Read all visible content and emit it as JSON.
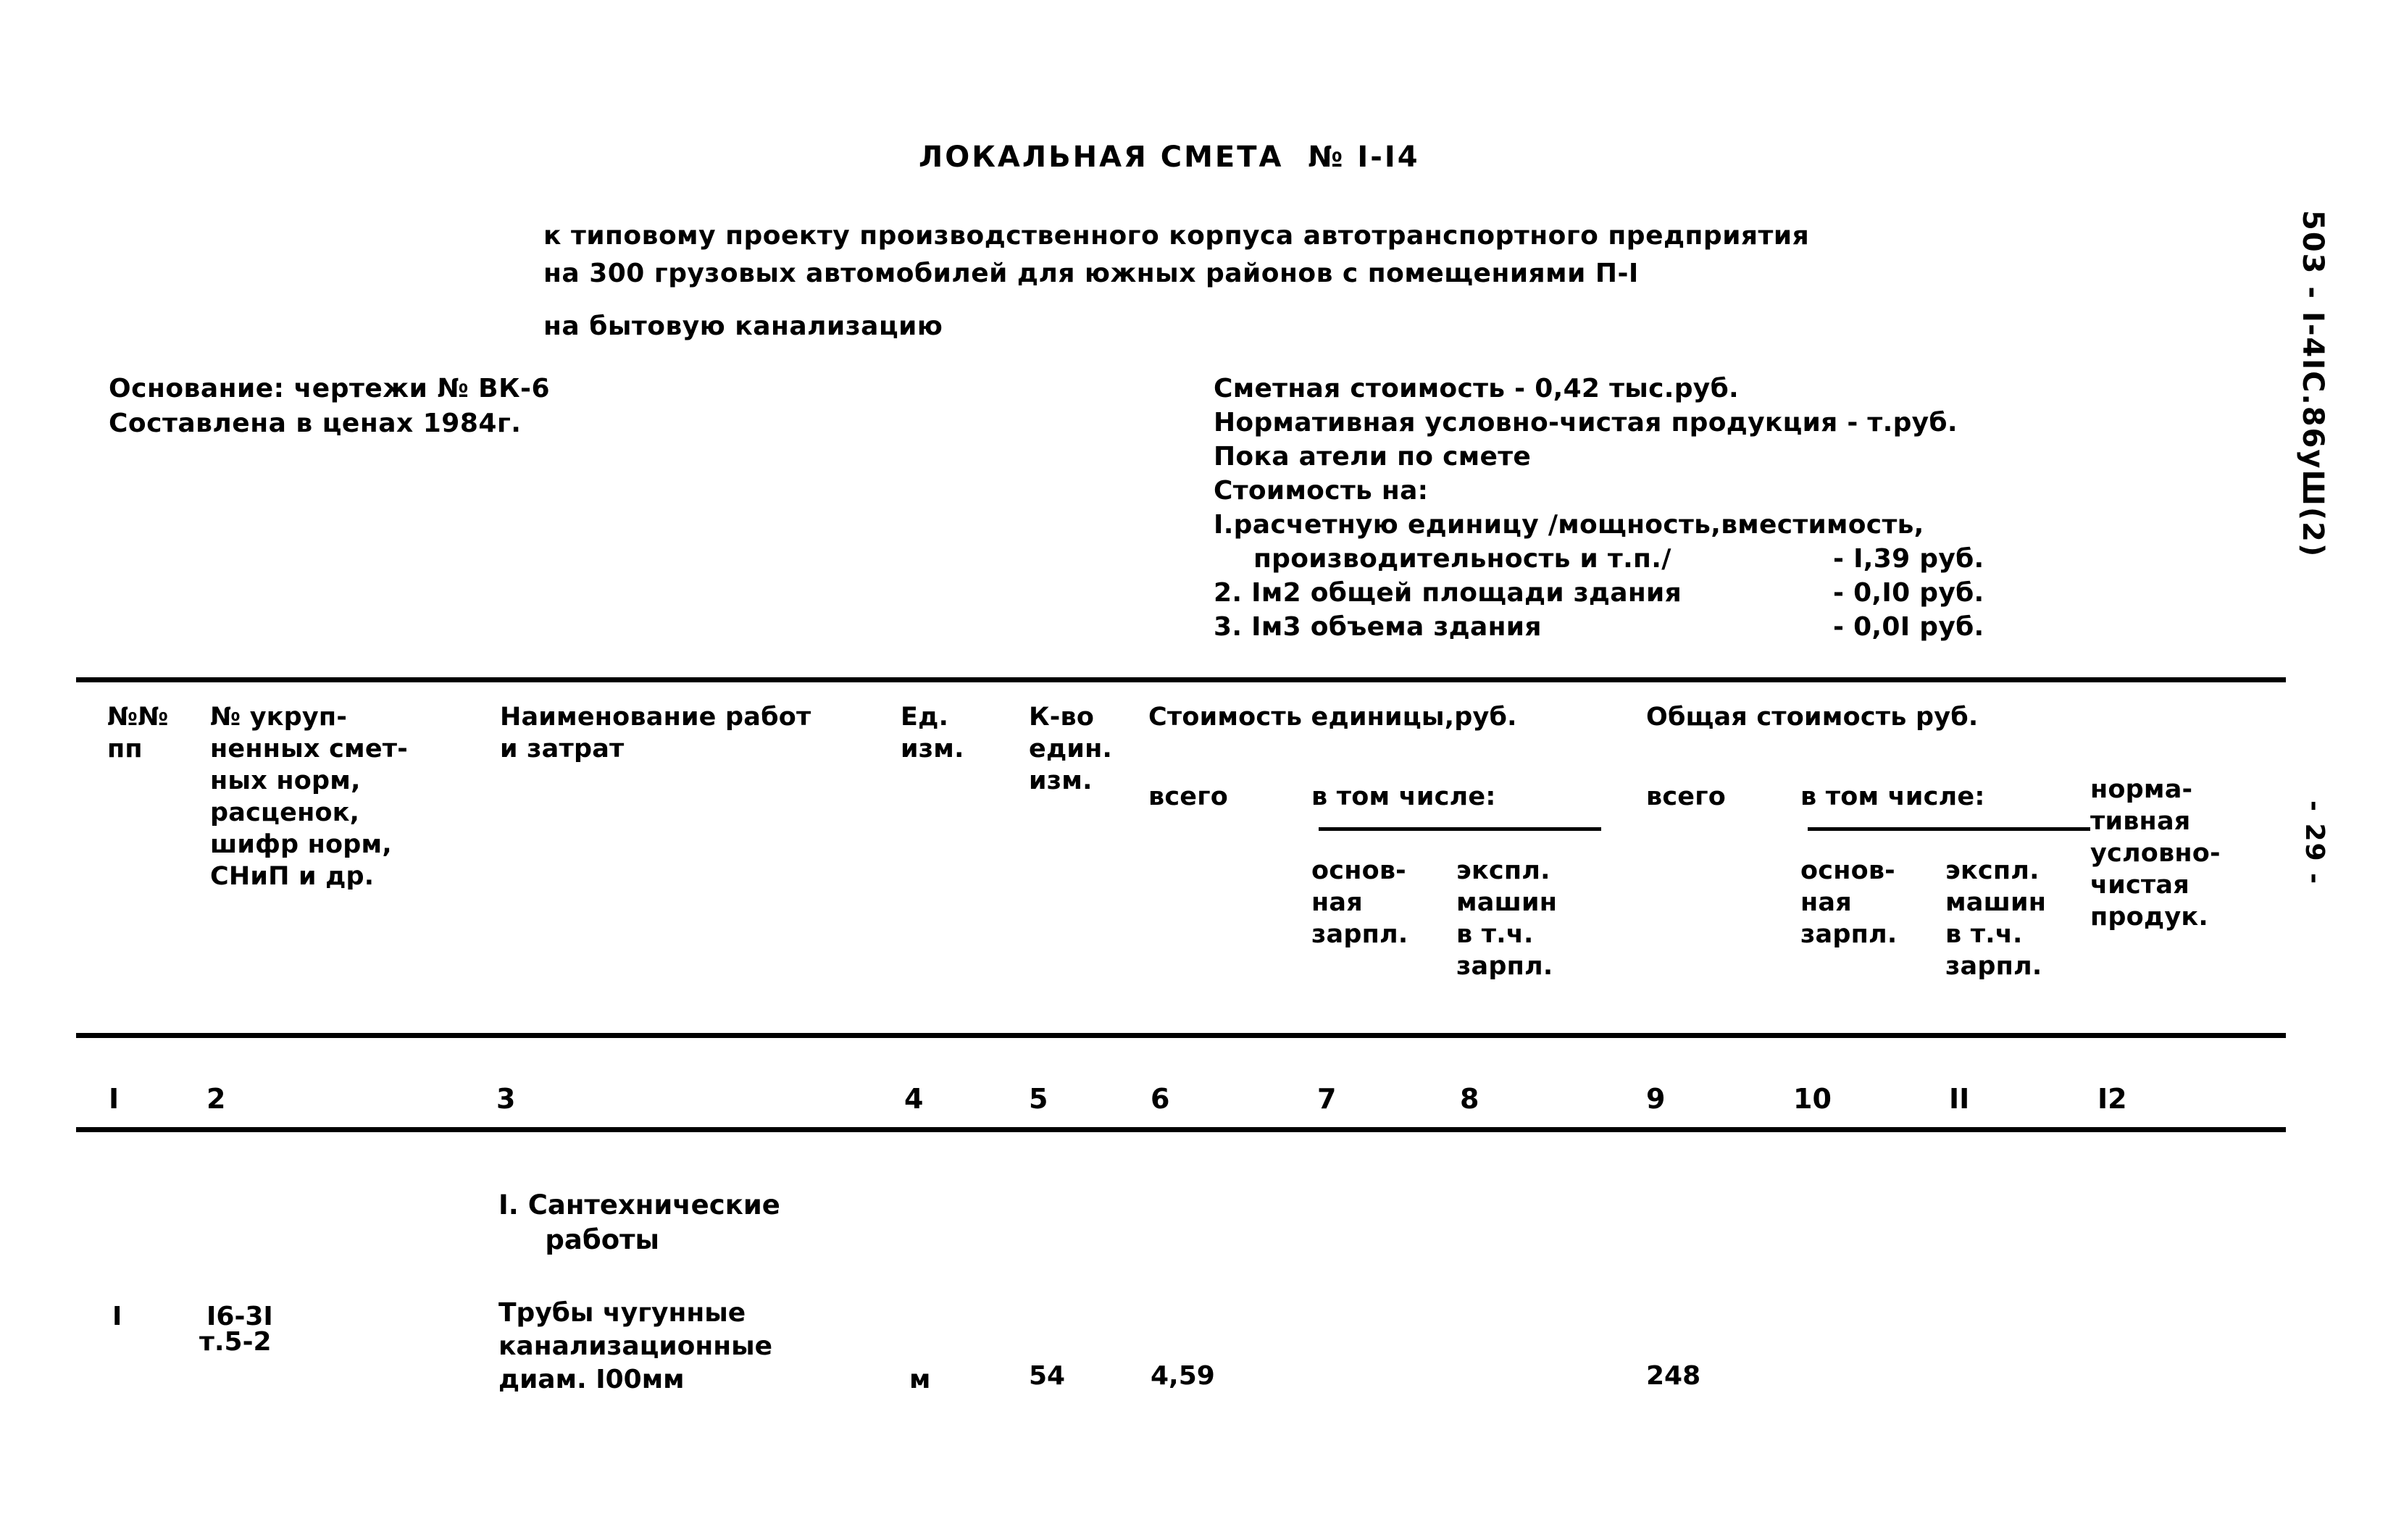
{
  "document": {
    "title": "ЛОКАЛЬНАЯ СМЕТА  № I-I4",
    "subtitle_line1": "к типовому проекту производственного корпуса автотранспортного предприятия",
    "subtitle_line2": "на 300 грузовых автомобилей для южных районов с помещениями П-I",
    "subtitle_line3": "на бытовую канализацию"
  },
  "basis": {
    "line1": "Основание: чертежи № ВК-6",
    "line2": "Составлена в ценах 1984г."
  },
  "summary": {
    "estimate_cost": "Сметная стоимость - 0,42 тыс.руб.",
    "normative_product": "Нормативная условно-чистая продукция - т.руб.",
    "indicators_note": "Пока атели по смете",
    "cost_for": "Стоимость на:",
    "items": [
      {
        "label_line1": "I.расчетную единицу /мощность,вместимость,",
        "label_line2": "производительность и т.п./",
        "value": "- I,39 руб."
      },
      {
        "label_line1": "2. Iм2 общей площади здания",
        "label_line2": "",
        "value": "- 0,I0 руб."
      },
      {
        "label_line1": "3. Iм3 объема здания",
        "label_line2": "",
        "value": "- 0,0I руб."
      }
    ]
  },
  "table": {
    "headers": {
      "col1": "№№\nпп",
      "col2": "№ укруп-\nненных смет-\nных норм,\nрасценок,\nшифр норм,\nСНиП и др.",
      "col3": "Наименование работ\nи затрат",
      "col4": "Ед.\nизм.",
      "col5": "К-во\nедин.\nизм.",
      "group_unit_cost": "Стоимость единицы,руб.",
      "group_total_cost": "Общая стоимость руб.",
      "unit_total": "всего",
      "unit_inclusive": "в том числе:",
      "unit_basic_wage": "основ-\nная\nзарпл.",
      "unit_machine": "экспл.\nмашин\nв т.ч.\nзарпл.",
      "total_total": "всего",
      "total_inclusive": "в том числе:",
      "total_basic_wage": "основ-\nная\nзарпл.",
      "total_machine": "экспл.\nмашин\nв т.ч.\nзарпл.",
      "col12": "норма-\nтивная\nусловно-\nчистая\nпродук."
    },
    "column_numbers": [
      "I",
      "2",
      "3",
      "4",
      "5",
      "6",
      "7",
      "8",
      "9",
      "10",
      "II",
      "I2"
    ],
    "section_heading": "I. Сантехнические\n     работы",
    "rows": [
      {
        "num": "I",
        "code_line1": "I6-3I",
        "code_line2": "т.5-2",
        "name_line1": "Трубы чугунные",
        "name_line2": "канализационные",
        "name_line3": "диам. I00мм",
        "unit": "м",
        "quantity": "54",
        "unit_cost_total": "4,59",
        "unit_cost_basic_wage": "",
        "unit_cost_machine": "",
        "total_cost_total": "248",
        "total_cost_basic_wage": "",
        "total_cost_machine": "",
        "normative_product": ""
      }
    ]
  },
  "margins": {
    "code": "503 - I-4IС.86уШ(2)",
    "page": "- 29 -"
  }
}
